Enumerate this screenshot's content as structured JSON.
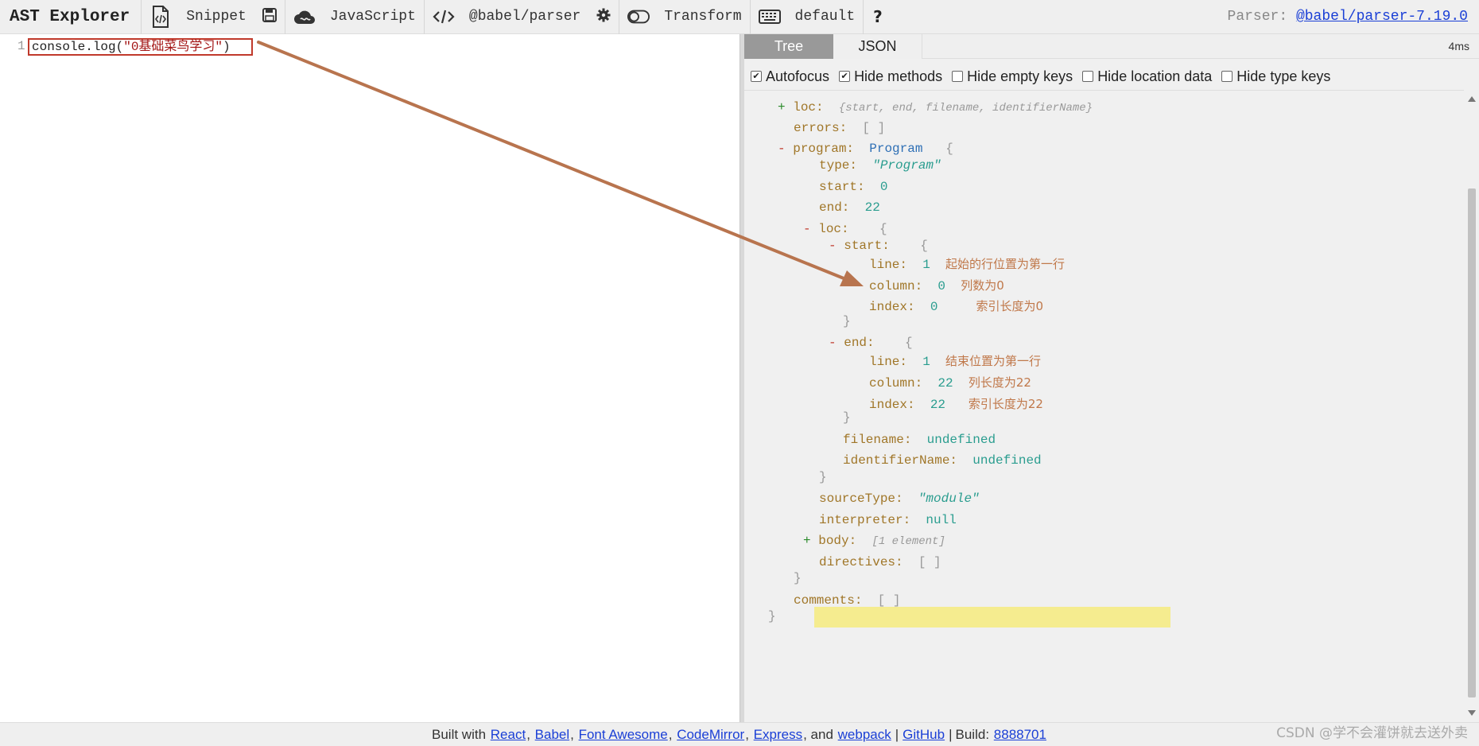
{
  "toolbar": {
    "brand": "AST Explorer",
    "snippet": "Snippet",
    "language": "JavaScript",
    "parser": "@babel/parser",
    "transform": "Transform",
    "keymap": "default",
    "help": "?",
    "parser_info_prefix": "Parser:",
    "parser_info_link": "@babel/parser-7.19.0"
  },
  "editor": {
    "line_number": "1",
    "code_prefix": "console.log(",
    "code_string": "\"0基础菜鸟学习\"",
    "code_suffix": ")"
  },
  "tabs": {
    "tree": "Tree",
    "json": "JSON",
    "timing": "4ms"
  },
  "options": {
    "autofocus": {
      "label": "Autofocus",
      "checked": true
    },
    "hide_methods": {
      "label": "Hide methods",
      "checked": true
    },
    "hide_empty": {
      "label": "Hide empty keys",
      "checked": false
    },
    "hide_location": {
      "label": "Hide location data",
      "checked": false
    },
    "hide_type": {
      "label": "Hide type keys",
      "checked": false
    }
  },
  "tree": {
    "loc_key": "loc:",
    "loc_summary": "{start, end, filename, identifierName}",
    "errors_key": "errors:",
    "empty_array": "[ ]",
    "program_key": "program:",
    "program_type": "Program",
    "open_brace": "{",
    "close_brace": "}",
    "type_key": "type:",
    "type_val": "\"Program\"",
    "start_key": "start:",
    "start_val": "0",
    "end_key": "end:",
    "end_val": "22",
    "loc2_key": "loc:",
    "start_obj_key": "start:",
    "line_key": "line:",
    "line_val": "1",
    "column_key": "column:",
    "column_val": "0",
    "index_key": "index:",
    "index_val": "0",
    "end_obj_key": "end:",
    "end_line_val": "1",
    "end_column_val": "22",
    "end_index_val": "22",
    "filename_key": "filename:",
    "filename_val": "undefined",
    "identifier_key": "identifierName:",
    "identifier_val": "undefined",
    "sourcetype_key": "sourceType:",
    "sourcetype_val": "\"module\"",
    "interpreter_key": "interpreter:",
    "interpreter_val": "null",
    "body_key": "body:",
    "body_val": "[1 element]",
    "directives_key": "directives:",
    "comments_key": "comments:",
    "plus": "+",
    "minus": "-"
  },
  "notes": {
    "start_line": "起始的行位置为第一行",
    "start_column": "列数为0",
    "start_index": "索引长度为0",
    "end_line": "结束位置为第一行",
    "end_column": "列长度为22",
    "end_index": "索引长度为22"
  },
  "footer": {
    "built_with": "Built with",
    "react": "React",
    "babel": "Babel",
    "font_awesome": "Font Awesome",
    "codemirror": "CodeMirror",
    "express": "Express",
    "and": ", and",
    "webpack": "webpack",
    "github": "GitHub",
    "build_label": "Build:",
    "build_hash": "8888701",
    "watermark": "CSDN @学不会灌饼就去送外卖"
  },
  "colors": {
    "annotation": "#b8744e",
    "highlight": "#f5ec8f",
    "active_tab": "#999999",
    "link": "#1a3fd6"
  },
  "icons": {
    "snippet": "file-code-icon",
    "save": "save-icon",
    "language": "cloud-icon",
    "parser": "code-icon",
    "settings": "gear-icon",
    "transform": "toggle-icon",
    "keymap": "keyboard-icon",
    "help": "question-icon"
  }
}
